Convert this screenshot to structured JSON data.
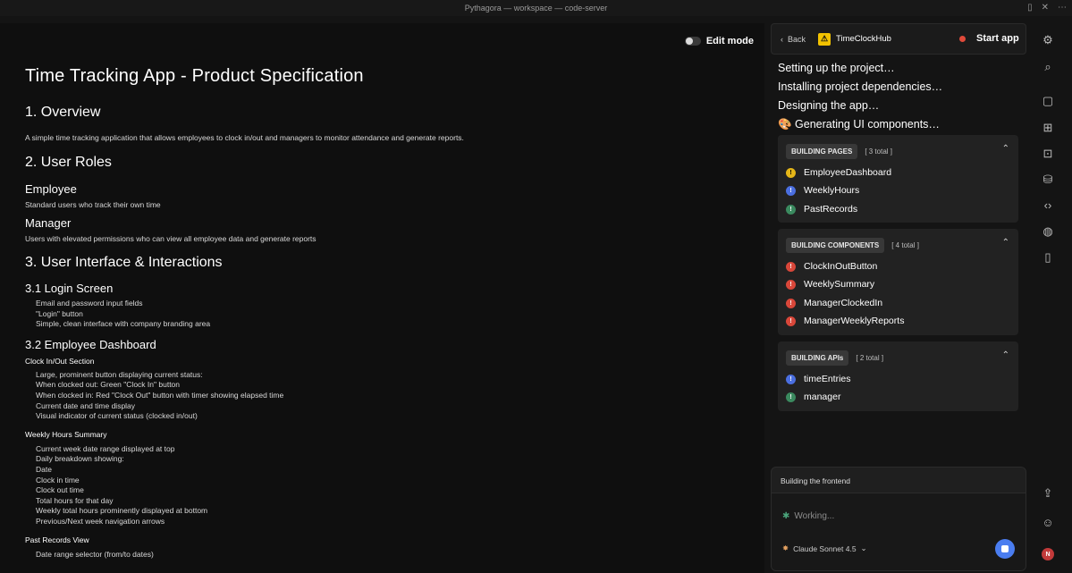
{
  "window": {
    "title": "Pythagora — workspace — code-server"
  },
  "doc": {
    "edit_mode_label": "Edit mode",
    "title": "Time Tracking App - Product Specification",
    "s1_title": "1. Overview",
    "s1_text": "A simple time tracking application that allows employees to clock in/out and managers to monitor attendance and generate reports.",
    "s2_title": "2. User Roles",
    "role1_title": "Employee",
    "role1_text": "Standard users who track their own time",
    "role2_title": "Manager",
    "role2_text": "Users with elevated permissions who can view all employee data and generate reports",
    "s3_title": "3. User Interface & Interactions",
    "s31_title": "3.1 Login Screen",
    "s31_items": [
      "Email and password input fields",
      "\"Login\" button",
      "Simple, clean interface with company branding area"
    ],
    "s32_title": "3.2 Employee Dashboard",
    "clock_section": "Clock In/Out Section",
    "clock_items": [
      "Large, prominent button displaying current status:",
      "When clocked out: Green \"Clock In\" button",
      "When clocked in: Red \"Clock Out\" button with timer showing elapsed time",
      "Current date and time display",
      "Visual indicator of current status (clocked in/out)"
    ],
    "weekly_section": "Weekly Hours Summary",
    "weekly_items": [
      "Current week date range displayed at top",
      "Daily breakdown showing:",
      "Date",
      "Clock in time",
      "Clock out time",
      "Total hours for that day",
      "Weekly total hours prominently displayed at bottom",
      "Previous/Next week navigation arrows"
    ],
    "past_section": "Past Records View",
    "past_items": [
      "Date range selector (from/to dates)"
    ]
  },
  "panel": {
    "back_label": "Back",
    "app_name": "TimeClockHub",
    "start_label": "Start app",
    "progress": [
      "Setting up the project…",
      "Installing project dependencies…",
      "Designing the app…",
      "🎨 Generating UI components…"
    ],
    "pages": {
      "label": "BUILDING PAGES",
      "count": "[ 3 total ]",
      "items": [
        "EmployeeDashboard",
        "WeeklyHours",
        "PastRecords"
      ]
    },
    "components": {
      "label": "BUILDING COMPONENTS",
      "count": "[ 4 total ]",
      "items": [
        "ClockInOutButton",
        "WeeklySummary",
        "ManagerClockedIn",
        "ManagerWeeklyReports"
      ]
    },
    "apis": {
      "label": "BUILDING APIs",
      "count": "[ 2 total ]",
      "items": [
        "timeEntries",
        "manager"
      ]
    },
    "status": "Building the frontend",
    "working": "Working...",
    "model": "Claude Sonnet 4.5"
  },
  "avatar_initial": "N",
  "colors": {
    "accent": "#4a7df0",
    "warn": "#e5b618",
    "error": "#d9473a",
    "success": "#3b8a5f"
  }
}
